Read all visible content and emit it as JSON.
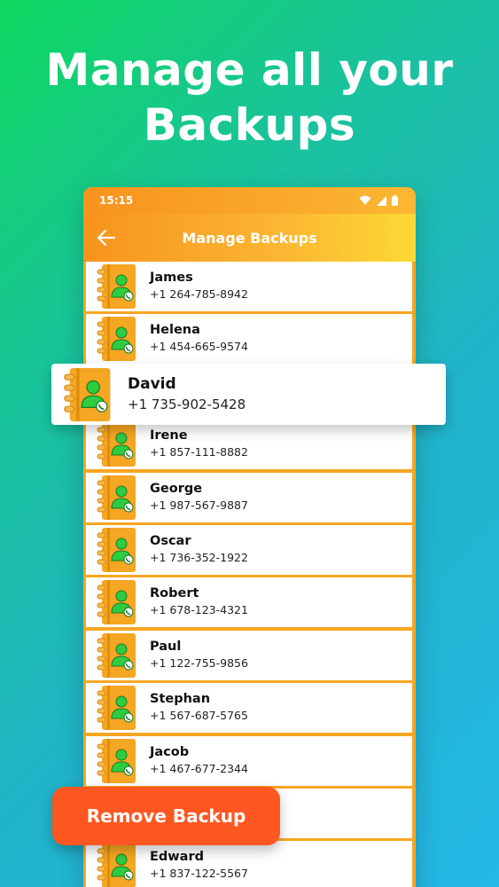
{
  "headline": {
    "line1": "Manage all your",
    "line2": "Backups"
  },
  "statusbar": {
    "time": "15:15",
    "icons": [
      "wifi-icon",
      "cell-signal-icon",
      "battery-icon"
    ]
  },
  "appbar": {
    "title": "Manage Backups",
    "back_icon": "arrow-left-icon"
  },
  "contacts": [
    {
      "name": "James",
      "phone": "+1 264-785-8942"
    },
    {
      "name": "Helena",
      "phone": "+1 454-665-9574"
    },
    {
      "name": "David",
      "phone": "+1 735-902-5428"
    },
    {
      "name": "Irene",
      "phone": "+1 857-111-8882"
    },
    {
      "name": "George",
      "phone": "+1 987-567-9887"
    },
    {
      "name": "Oscar",
      "phone": "+1 736-352-1922"
    },
    {
      "name": "Robert",
      "phone": "+1 678-123-4321"
    },
    {
      "name": "Paul",
      "phone": "+1 122-755-9856"
    },
    {
      "name": "Stephan",
      "phone": "+1 567-687-5765"
    },
    {
      "name": "Jacob",
      "phone": "+1 467-677-2344"
    },
    {
      "name": "",
      "phone": ""
    },
    {
      "name": "Edward",
      "phone": "+1 837-122-5567"
    }
  ],
  "featured": {
    "name": "David",
    "phone": "+1 735-902-5428"
  },
  "remove_button": {
    "label": "Remove Backup",
    "color": "#fe5722"
  },
  "colors": {
    "accent": "#f7931e",
    "avatar_green": "#2ecc40"
  }
}
